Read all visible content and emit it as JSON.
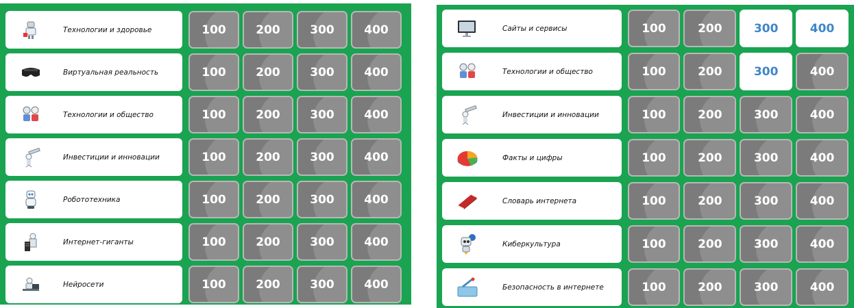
{
  "left_board": {
    "rows": [
      {
        "label": "Технологии и здоровье",
        "icon": "robot-doctor-icon",
        "values": [
          "100",
          "200",
          "300",
          "400"
        ],
        "open": [
          false,
          false,
          false,
          false
        ]
      },
      {
        "label": "Виртуальная реальность",
        "icon": "vr-headset-icon",
        "values": [
          "100",
          "200",
          "300",
          "400"
        ],
        "open": [
          false,
          false,
          false,
          false
        ]
      },
      {
        "label": "Технологии и общество",
        "icon": "robots-pair-icon",
        "values": [
          "100",
          "200",
          "300",
          "400"
        ],
        "open": [
          false,
          false,
          false,
          false
        ]
      },
      {
        "label": "Инвестиции и инновации",
        "icon": "telescope-robot-icon",
        "values": [
          "100",
          "200",
          "300",
          "400"
        ],
        "open": [
          false,
          false,
          false,
          false
        ]
      },
      {
        "label": "Робототехника",
        "icon": "robot-icon",
        "values": [
          "100",
          "200",
          "300",
          "400"
        ],
        "open": [
          false,
          false,
          false,
          false
        ]
      },
      {
        "label": "Интернет-гиганты",
        "icon": "server-robot-icon",
        "values": [
          "100",
          "200",
          "300",
          "400"
        ],
        "open": [
          false,
          false,
          false,
          false
        ]
      },
      {
        "label": "Нейросети",
        "icon": "robot-laptop-icon",
        "values": [
          "100",
          "200",
          "300",
          "400"
        ],
        "open": [
          false,
          false,
          false,
          false
        ]
      }
    ]
  },
  "right_board": {
    "rows": [
      {
        "label": "Сайты и сервисы",
        "icon": "monitor-icon",
        "values": [
          "100",
          "200",
          "300",
          "400"
        ],
        "open": [
          false,
          false,
          true,
          true
        ]
      },
      {
        "label": "Технологии и общество",
        "icon": "robots-pair-icon",
        "values": [
          "100",
          "200",
          "300",
          "400"
        ],
        "open": [
          false,
          false,
          true,
          false
        ]
      },
      {
        "label": "Инвестиции и инновации",
        "icon": "telescope-robot-icon",
        "values": [
          "100",
          "200",
          "300",
          "400"
        ],
        "open": [
          false,
          false,
          false,
          false
        ]
      },
      {
        "label": "Факты и цифры",
        "icon": "pie-chart-icon",
        "values": [
          "100",
          "200",
          "300",
          "400"
        ],
        "open": [
          false,
          false,
          false,
          false
        ]
      },
      {
        "label": "Словарь интернета",
        "icon": "red-book-icon",
        "values": [
          "100",
          "200",
          "300",
          "400"
        ],
        "open": [
          false,
          false,
          false,
          false
        ]
      },
      {
        "label": "Киберкультура",
        "icon": "robot-globe-icon",
        "values": [
          "100",
          "200",
          "300",
          "400"
        ],
        "open": [
          false,
          false,
          false,
          false
        ]
      },
      {
        "label": "Безопасность в интернете",
        "icon": "satellite-dish-icon",
        "values": [
          "100",
          "200",
          "300",
          "400"
        ],
        "open": [
          false,
          false,
          false,
          false
        ]
      }
    ]
  },
  "colors": {
    "board_green": "#1aa350",
    "cell_gray": "#7b7b7b",
    "open_text_blue": "#3f86c7"
  }
}
